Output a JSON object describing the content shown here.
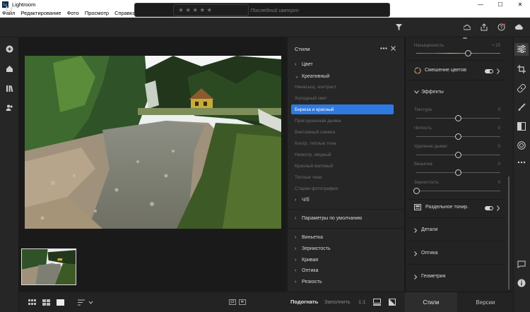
{
  "window": {
    "title": "Lightroom",
    "app_icon_text": "Lr",
    "min_glyph": "—",
    "max_glyph": "☐",
    "close_glyph": "✕"
  },
  "menu": [
    "Файл",
    "Редактирование",
    "Фото",
    "Просмотр",
    "Справка"
  ],
  "topbar": {
    "logo": "Lr",
    "search_placeholder": "Поиск Последний импорт"
  },
  "presets_panel": {
    "title": "Стили",
    "groups": {
      "color": "Цвет",
      "creative": "Креативный",
      "bw": "Ч/б",
      "default_params": "Параметры по умолчанию",
      "vignette": "Виньетка",
      "grain": "Зернистость",
      "curve": "Кривая",
      "optics": "Оптика",
      "sharpness": "Резкость"
    },
    "creative_items": [
      "Ненасыщ. контраст",
      "Холодный свет",
      "Бирюза и красный",
      "Приглушенная дымка",
      "Винтажный снимок",
      "Контр. теплые тона",
      "Низкотр. медный",
      "Красный матовый",
      "Теплые тени",
      "Старая фотография"
    ],
    "selected_item": "Бирюза и красный"
  },
  "edit_panel": {
    "saturation": {
      "label": "Насыщенность",
      "value": "+ 25",
      "level": 0.62
    },
    "color_mix": {
      "label": "Смешение цветов",
      "enabled": true
    },
    "effects": {
      "header": "Эффекты",
      "sliders": [
        {
          "label": "Текстура",
          "value": "0",
          "level": 0.5
        },
        {
          "label": "Четкость",
          "value": "0",
          "level": 0.5
        },
        {
          "label": "Удаление дымки",
          "value": "0",
          "level": 0.5
        },
        {
          "label": "Виньетка",
          "value": "0",
          "level": 0.5
        },
        {
          "label": "Зернистость",
          "value": "0",
          "level": 0.0
        }
      ]
    },
    "split_toning": {
      "label": "Раздельное тонир.",
      "enabled": true
    },
    "sections": {
      "details": "Детали",
      "optics": "Оптика",
      "geometry": "Геометрия"
    }
  },
  "bottom_bar": {
    "zoom_fit": "Подогнать",
    "zoom_fill": "Заполнить",
    "zoom_1to1": "1:1",
    "stars": "★★★★★"
  },
  "tabs": {
    "styles": "Стили",
    "versions": "Версии"
  },
  "colors": {
    "accent": "#2f7ae0",
    "panel_bg": "#262626",
    "app_bg": "#1c1c1c"
  }
}
